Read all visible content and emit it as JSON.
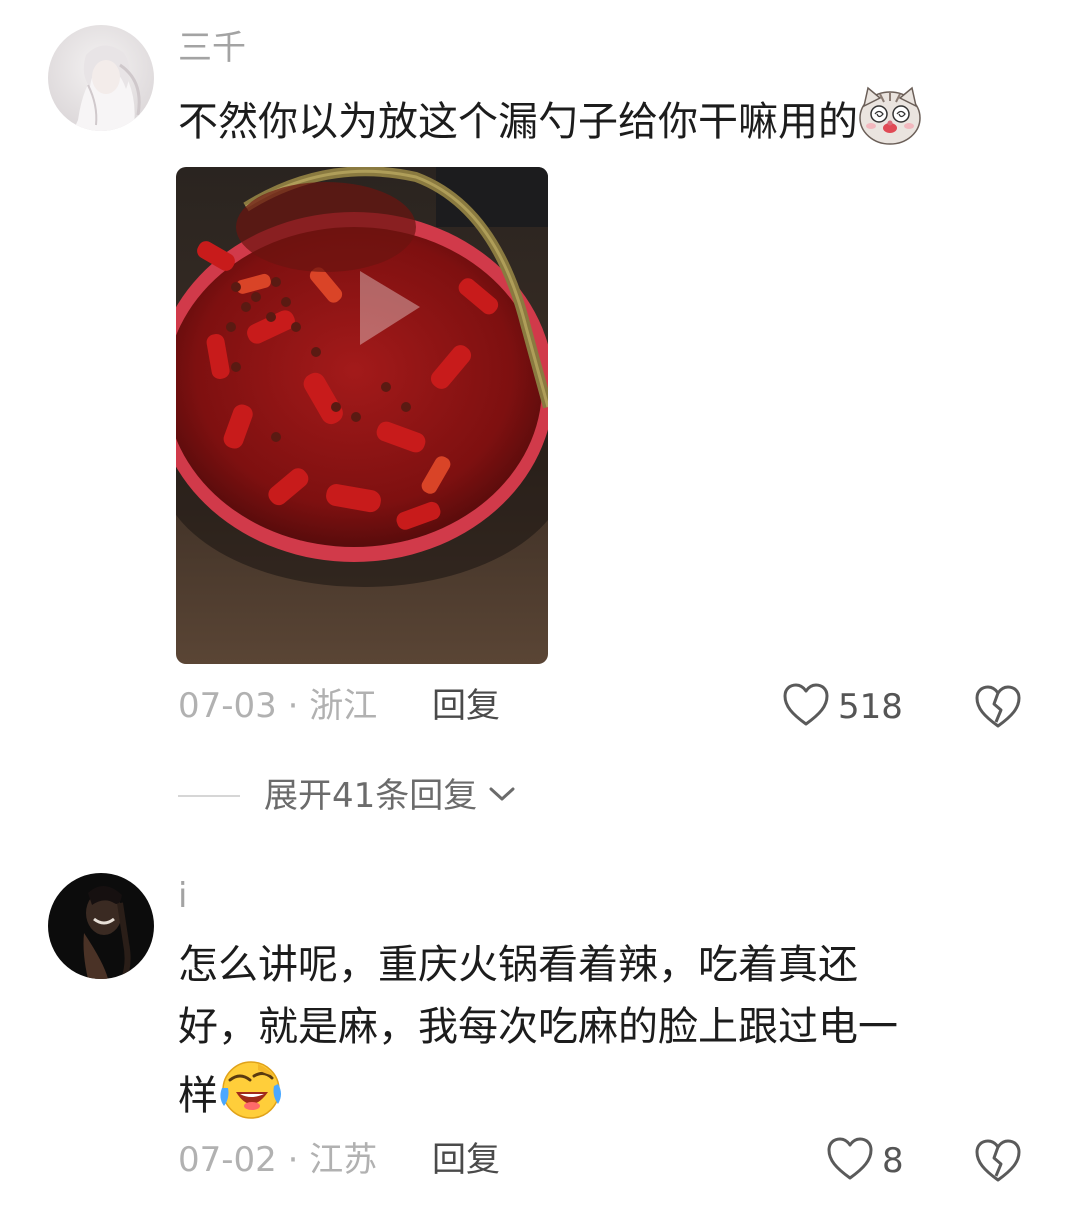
{
  "comments": [
    {
      "username": "三千",
      "text": "不然你以为放这个漏勺子给你干嘛用的",
      "emoji": "cat-dizzy-face-icon",
      "has_video": true,
      "date_location": "07-03 · 浙江",
      "reply_label": "回复",
      "likes": "518",
      "expand_replies": "展开41条回复"
    },
    {
      "username": "i",
      "text_lines": [
        "怎么讲呢，重庆火锅看着辣，吃着真还",
        "好，就是麻，我每次吃麻的脸上跟过电一",
        "样"
      ],
      "emoji": "laughing-crying-face-icon",
      "date_location": "07-02 · 江苏",
      "reply_label": "回复",
      "likes": "8"
    }
  ],
  "colors": {
    "meta_gray": "#b1b1b1",
    "text_dark": "#1c1c1c",
    "icon_gray": "#5a5a5a"
  }
}
